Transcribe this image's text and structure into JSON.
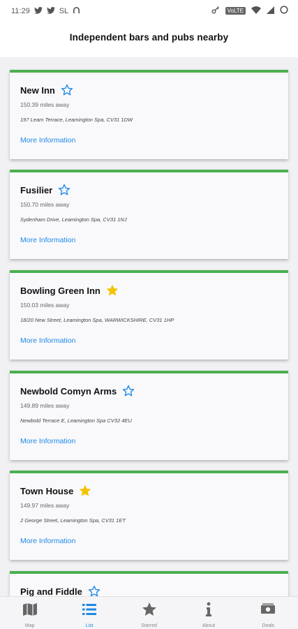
{
  "status_bar": {
    "time": "11:29",
    "carrier": "SL",
    "data_badge": "VoLTE"
  },
  "header": {
    "title": "Independent bars and pubs nearby"
  },
  "colors": {
    "accent_green": "#4caf50",
    "link_blue": "#1e88e5",
    "star_gold": "#f2c500"
  },
  "pubs": [
    {
      "name": "New Inn",
      "distance": "150.39 miles away",
      "address": "197 Leam Terrace, Leamington Spa, CV31 1DW",
      "more": "More Information",
      "starred": false
    },
    {
      "name": "Fusilier",
      "distance": "150.70 miles away",
      "address": "Sydenham Drive, Leamington Spa, CV31 1NJ",
      "more": "More Information",
      "starred": false
    },
    {
      "name": "Bowling Green Inn",
      "distance": "150.03 miles away",
      "address": "18/20 New Street, Leamington Spa, WARWICKSHIRE, CV31 1HP",
      "more": "More Information",
      "starred": true
    },
    {
      "name": "Newbold Comyn Arms",
      "distance": "149.89 miles away",
      "address": "Newbold Terrace E, Leamington Spa CV32 4EU",
      "more": "More Information",
      "starred": false
    },
    {
      "name": "Town House",
      "distance": "149.97 miles away",
      "address": "2 George Street, Leamington Spa, CV31 1ET",
      "more": "More Information",
      "starred": true
    },
    {
      "name": "Pig and Fiddle",
      "distance": "",
      "address": "",
      "more": "",
      "starred": false
    }
  ],
  "tabs": [
    {
      "label": "Map",
      "icon": "map-icon",
      "active": false
    },
    {
      "label": "List",
      "icon": "list-icon",
      "active": true
    },
    {
      "label": "Starred",
      "icon": "star-icon",
      "active": false
    },
    {
      "label": "About",
      "icon": "info-icon",
      "active": false
    },
    {
      "label": "Deals",
      "icon": "money-icon",
      "active": false
    }
  ]
}
